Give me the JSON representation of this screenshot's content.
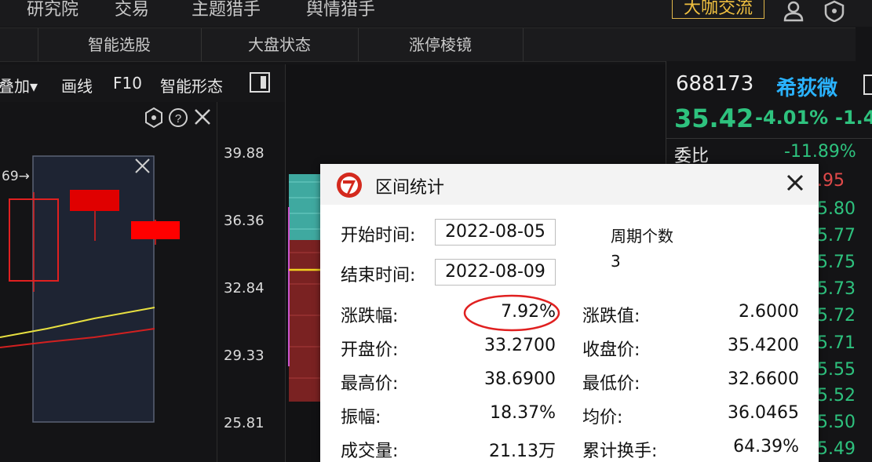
{
  "topnav": {
    "items": [
      "研究院",
      "交易",
      "主题猎手",
      "舆情猎手"
    ],
    "daka_label": "大咖交流"
  },
  "subnav": {
    "items": [
      "智能选股",
      "大盘状态",
      "涨停棱镜"
    ]
  },
  "toolbar": {
    "overlay_label": "叠加▾",
    "draw_label": "画线",
    "f10_label": "F10",
    "pattern_label": "智能形态"
  },
  "chart": {
    "yticks": [
      "39.88",
      "36.36",
      "32.84",
      "29.33",
      "25.81"
    ],
    "annotation": "69→",
    "colors": {
      "up": "#e02020",
      "down": "#e00000",
      "ma1": "#e8e040",
      "ma2": "#d22020",
      "selection": "#1e2433"
    }
  },
  "quote": {
    "code": "688173",
    "name": "希荻微",
    "price": "35.42",
    "pct": "-4.01%",
    "change": "-1.4",
    "weibi_label": "委比",
    "weibi_value": "-11.89%",
    "order_prices": [
      ".95",
      "5.80",
      "5.77",
      "5.75",
      "5.73",
      "5.72",
      "5.71",
      "5.55",
      "5.52",
      "5.50",
      "5.49"
    ],
    "colors": {
      "down": "#2ec27e",
      "up": "#e24a4a",
      "name": "#2ab3ff"
    }
  },
  "dialog": {
    "title": "区间统计",
    "start_label": "开始时间:",
    "start_value": "2022-08-05",
    "end_label": "结束时间:",
    "end_value": "2022-08-09",
    "period_label": "周期个数",
    "period_value": "3",
    "stats_left": [
      {
        "label": "涨跌幅:",
        "value": "7.92%"
      },
      {
        "label": "开盘价:",
        "value": "33.2700"
      },
      {
        "label": "最高价:",
        "value": "38.6900"
      },
      {
        "label": "振幅:",
        "value": "18.37%"
      },
      {
        "label": "成交量:",
        "value": "21.13万"
      }
    ],
    "stats_right": [
      {
        "label": "涨跌值:",
        "value": "2.6000"
      },
      {
        "label": "收盘价:",
        "value": "35.4200"
      },
      {
        "label": "最低价:",
        "value": "32.6600"
      },
      {
        "label": "均价:",
        "value": "36.0465"
      },
      {
        "label": "累计换手:",
        "value": "64.39%"
      }
    ]
  }
}
